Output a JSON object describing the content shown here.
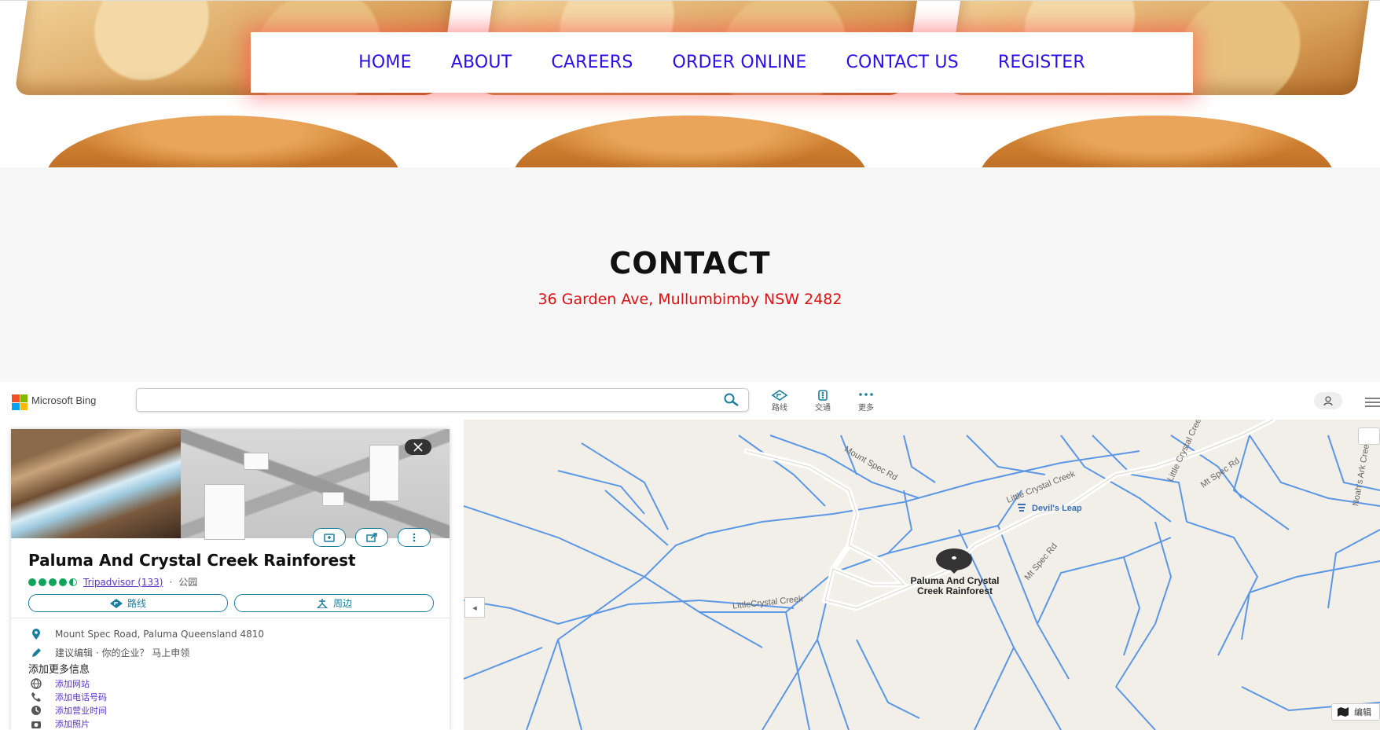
{
  "nav": {
    "items": [
      "HOME",
      "ABOUT",
      "CAREERS",
      "ORDER ONLINE",
      "CONTACT US",
      "REGISTER"
    ]
  },
  "contact": {
    "heading": "CONTACT",
    "address": "36 Garden Ave, Mullumbimby NSW 2482"
  },
  "bing": {
    "brand": "Microsoft Bing",
    "search_value": "",
    "tools": [
      {
        "label": "路线",
        "icon": "directions-icon"
      },
      {
        "label": "交通",
        "icon": "traffic-icon"
      },
      {
        "label": "更多",
        "icon": "more-icon"
      }
    ],
    "map": {
      "pin_label_line1": "Paluma And Crystal",
      "pin_label_line2": "Creek Rainforest",
      "devils_leap": "Devil's Leap",
      "road_mount_spec": "Mount Spec Rd",
      "road_little_crystal": "Little Crystal Creek",
      "road_mt_spec": "Mt Spec Rd",
      "road_mt_spec_2": "Mt Spec Rd",
      "road_little_crystal_2": "LittleCrystal Creek",
      "road_crystal": "Little Crystal Creek",
      "road_noahs": "Noah's Ark Creek",
      "mode_label": "编辑",
      "colors": {
        "water": "#5b97e5",
        "land": "#f2efe9",
        "road": "#ffffff"
      }
    },
    "panel": {
      "title": "Paluma And Crystal Creek Rainforest",
      "rating_source": "Tripadvisor (133)",
      "separator": "·",
      "category": "公园",
      "action_directions": "路线",
      "action_nearby": "周边",
      "address": "Mount Spec Road, Paluma Queensland 4810",
      "suggest": "建议编辑 · 你的企业？ 马上申领",
      "more_info_title": "添加更多信息",
      "links": [
        "添加网站",
        "添加电话号码",
        "添加营业时间",
        "添加照片"
      ],
      "rating_value": 4.5
    }
  }
}
